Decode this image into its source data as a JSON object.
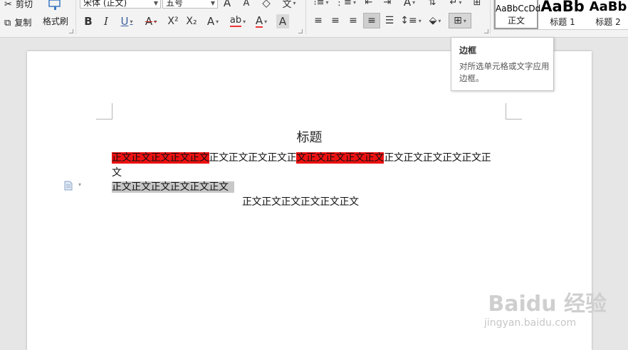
{
  "ribbon": {
    "clipboard": {
      "cut_label": "剪切",
      "copy_label": "复制",
      "format_painter_label": "格式刷"
    },
    "font": {
      "name_value": "宋体 (正文)",
      "size_value": "五号"
    },
    "styles": [
      {
        "preview": "AaBbCcDd",
        "label": "正文"
      },
      {
        "preview": "AaBb",
        "label": "标题 1"
      },
      {
        "preview": "AaBb",
        "label": "标题 2"
      }
    ],
    "icons": {
      "bold": "B",
      "italic": "I",
      "underline": "U",
      "strikethrough": "A",
      "superscript": "X²",
      "subscript": "X₂",
      "text_effect": "A",
      "highlight": "ab",
      "font_color": "A",
      "char_shading": "A",
      "grow_font": "A",
      "shrink_font": "A",
      "clear_format": "◇",
      "phonetic": "文"
    }
  },
  "tooltip": {
    "title": "边框",
    "description": "对所选单元格或文字应用边框。"
  },
  "document": {
    "title": "标题",
    "line1": {
      "seg1": "正文正文正文正文正文",
      "seg2": "正文正文正文正文正",
      "seg3": "文正文正文正文正文",
      "seg4": "正文正文正文正文正文正"
    },
    "line2": "文",
    "line3": "正文正文正文正文正文正文",
    "line4": "正文正文正文正文正文正文"
  },
  "watermark": {
    "brand": "Baidu 经验",
    "url": "jingyan.baidu.com"
  }
}
